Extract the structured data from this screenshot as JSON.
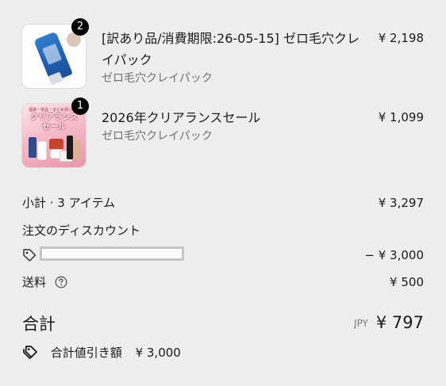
{
  "line_items": [
    {
      "quantity": "2",
      "title": "[訳あり品/消費期限:26-05-15] ゼロ毛穴クレイパック",
      "variant": "ゼロ毛穴クレイパック",
      "price": "¥ 2,198",
      "image_icon": "tube-product-image"
    },
    {
      "quantity": "1",
      "title": "2026年クリアランスセール",
      "variant": "ゼロ毛穴クレイパック",
      "price": "¥ 1,099",
      "image_icon": "sale-banner-image",
      "image_text": {
        "top": "福袋・単品・まとめ買い",
        "headline_1": "クリアランス",
        "headline_2": "セール"
      }
    }
  ],
  "summary": {
    "subtotal_label": "小計 · 3 アイテム",
    "subtotal_value": "¥ 3,297",
    "discount_heading": "注文のディスカウント",
    "discount_amount": "− ¥ 3,000",
    "shipping_label": "送料",
    "shipping_value": "¥ 500",
    "total_label": "合計",
    "currency_code": "JPY",
    "total_value": "¥ 797",
    "savings_label": "合計値引き額",
    "savings_value": "¥ 3,000"
  },
  "icons": {
    "discount_tag": "tag-icon",
    "shipping_help": "question-circle-icon",
    "savings": "double-tag-icon"
  },
  "colors": {
    "background": "#eeeeee",
    "text": "#1a1a1a",
    "muted_text": "#707070",
    "badge": "#000000"
  }
}
